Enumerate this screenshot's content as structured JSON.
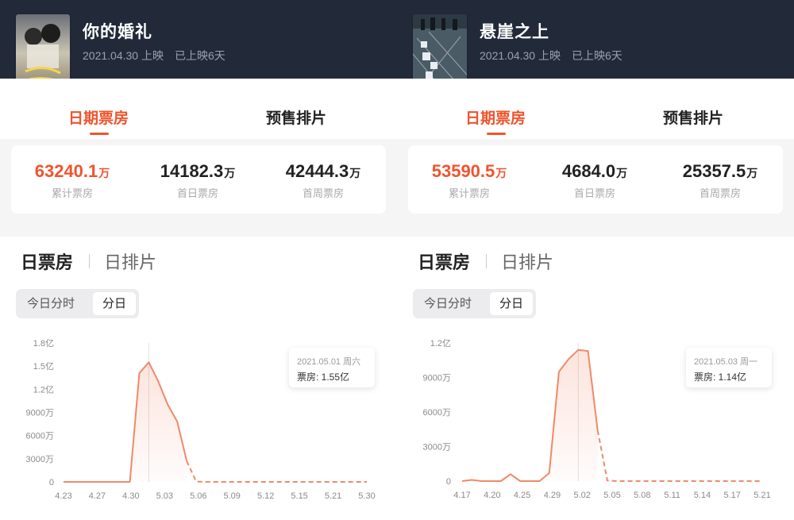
{
  "accent": "#f0542d",
  "panels": [
    {
      "movie": {
        "title": "你的婚礼",
        "release": "2021.04.30 上映",
        "days": "已上映6天"
      },
      "tabs": {
        "daily": "日期票房",
        "presale": "预售排片"
      },
      "stats": [
        {
          "value": "63240.1",
          "unit": "万",
          "label": "累计票房",
          "highlight": true
        },
        {
          "value": "14182.3",
          "unit": "万",
          "label": "首日票房",
          "highlight": false
        },
        {
          "value": "42444.3",
          "unit": "万",
          "label": "首周票房",
          "highlight": false
        }
      ],
      "chart_tabs": {
        "box_office": "日票房",
        "schedule": "日排片"
      },
      "segment": {
        "today": "今日分时",
        "daily": "分日"
      },
      "tooltip": {
        "date": "2021.05.01 周六",
        "value": "票房: 1.55亿"
      },
      "chart_data": {
        "type": "area",
        "y_ticks": [
          "1.8亿",
          "1.5亿",
          "1.2亿",
          "9000万",
          "6000万",
          "3000万",
          "0"
        ],
        "y_tick_values": [
          18000,
          15000,
          12000,
          9000,
          6000,
          3000,
          0
        ],
        "ylim": [
          0,
          18000
        ],
        "x_ticks": [
          "4.23",
          "4.27",
          "4.30",
          "5.03",
          "5.06",
          "5.09",
          "5.12",
          "5.15",
          "5.21",
          "5.30"
        ],
        "actual": [
          0,
          0,
          0,
          0,
          0,
          0,
          0,
          0,
          14100,
          15500,
          13000,
          10000,
          7800,
          2700
        ],
        "forecast": [
          2700,
          50,
          0,
          0,
          0,
          0,
          0,
          0,
          0,
          0,
          0,
          0,
          0,
          0,
          0,
          0,
          0,
          0,
          0,
          0
        ],
        "highlight_index": 9
      }
    },
    {
      "movie": {
        "title": "悬崖之上",
        "release": "2021.04.30 上映",
        "days": "已上映6天"
      },
      "tabs": {
        "daily": "日期票房",
        "presale": "预售排片"
      },
      "stats": [
        {
          "value": "53590.5",
          "unit": "万",
          "label": "累计票房",
          "highlight": true
        },
        {
          "value": "4684.0",
          "unit": "万",
          "label": "首日票房",
          "highlight": false
        },
        {
          "value": "25357.5",
          "unit": "万",
          "label": "首周票房",
          "highlight": false
        }
      ],
      "chart_tabs": {
        "box_office": "日票房",
        "schedule": "日排片"
      },
      "segment": {
        "today": "今日分时",
        "daily": "分日"
      },
      "tooltip": {
        "date": "2021.05.03 周一",
        "value": "票房: 1.14亿"
      },
      "chart_data": {
        "type": "area",
        "y_ticks": [
          "1.2亿",
          "9000万",
          "6000万",
          "3000万",
          "0"
        ],
        "y_tick_values": [
          12000,
          9000,
          6000,
          3000,
          0
        ],
        "ylim": [
          0,
          12000
        ],
        "x_ticks": [
          "4.17",
          "4.20",
          "4.25",
          "4.29",
          "5.02",
          "5.05",
          "5.08",
          "5.11",
          "5.14",
          "5.17",
          "5.21"
        ],
        "actual": [
          0,
          100,
          0,
          0,
          0,
          600,
          0,
          0,
          0,
          700,
          9500,
          10600,
          11400,
          11300,
          4400
        ],
        "forecast": [
          4400,
          50,
          0,
          0,
          0,
          0,
          0,
          0,
          0,
          0,
          0,
          0,
          0,
          0,
          0,
          0,
          0,
          0
        ],
        "highlight_index": 12
      }
    }
  ]
}
